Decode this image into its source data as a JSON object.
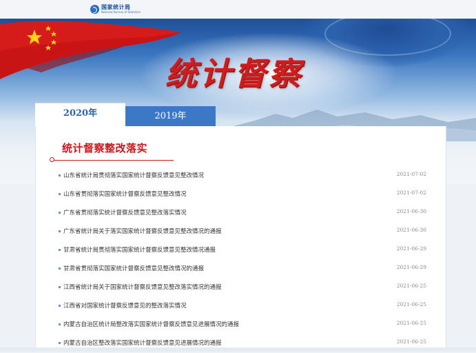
{
  "header": {
    "logo_cn": "国家统计局",
    "logo_en": "National Bureau of Statistics"
  },
  "banner": {
    "title": "统计督察"
  },
  "tabs": [
    {
      "label": "2020年",
      "active": true
    },
    {
      "label": "2019年",
      "active": false
    }
  ],
  "section": {
    "title": "统计督察整改落实"
  },
  "items": [
    {
      "title": "山东省统计局贯彻落实国家统计督察反馈意见整改情况",
      "date": "2021-07-02"
    },
    {
      "title": "山东省贯彻落实国家统计督察反馈意见整改情况",
      "date": "2021-07-02"
    },
    {
      "title": "广东省贯彻落实统计督察反馈意见整改落实情况",
      "date": "2021-06-30"
    },
    {
      "title": "广东省统计局关于落实国家统计督察反馈意见整改情况的通报",
      "date": "2021-06-30"
    },
    {
      "title": "甘肃省统计局贯彻落实国家统计督察反馈意见整改情况通报",
      "date": "2021-06-29"
    },
    {
      "title": "甘肃省贯彻落实国家统计督察反馈意见整改情况的通报",
      "date": "2021-06-29"
    },
    {
      "title": "江西省统计局关于国家统计督察反馈意见整改落实情况的通报",
      "date": "2021-06-25"
    },
    {
      "title": "江西省对国家统计督察反馈意见的整改落实情况",
      "date": "2021-06-25"
    },
    {
      "title": "内蒙古自治区统计局整改落实国家统计督察反馈意见进展情况的通报",
      "date": "2021-06-25"
    },
    {
      "title": "内蒙古自治区整改落实国家统计督察反馈意见进展情况的通报",
      "date": "2021-06-25"
    }
  ],
  "colors": {
    "accent_red": "#c8161d",
    "tab_blue": "#3b79c6",
    "active_tab_text": "#2a63a7"
  }
}
